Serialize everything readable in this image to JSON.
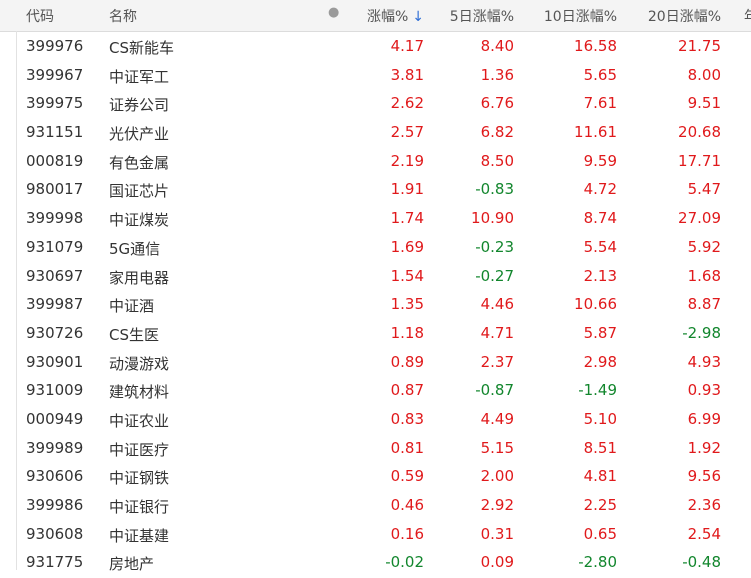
{
  "header": {
    "code": "代码",
    "name": "名称",
    "dot": "●",
    "chg": "涨幅%",
    "sort_icon": "↓",
    "chg5": "5日涨幅%",
    "chg10": "10日涨幅%",
    "chg20": "20日涨幅%",
    "more": "年"
  },
  "colors": {
    "up": "#e0191b",
    "down": "#12862d",
    "sort": "#2f6fd6"
  },
  "rows": [
    {
      "code": "399976",
      "name": "CS新能车",
      "chg": "4.17",
      "chg5": "8.40",
      "chg10": "16.58",
      "chg20": "21.75"
    },
    {
      "code": "399967",
      "name": "中证军工",
      "chg": "3.81",
      "chg5": "1.36",
      "chg10": "5.65",
      "chg20": "8.00"
    },
    {
      "code": "399975",
      "name": "证券公司",
      "chg": "2.62",
      "chg5": "6.76",
      "chg10": "7.61",
      "chg20": "9.51"
    },
    {
      "code": "931151",
      "name": "光伏产业",
      "chg": "2.57",
      "chg5": "6.82",
      "chg10": "11.61",
      "chg20": "20.68"
    },
    {
      "code": "000819",
      "name": "有色金属",
      "chg": "2.19",
      "chg5": "8.50",
      "chg10": "9.59",
      "chg20": "17.71"
    },
    {
      "code": "980017",
      "name": "国证芯片",
      "chg": "1.91",
      "chg5": "-0.83",
      "chg10": "4.72",
      "chg20": "5.47"
    },
    {
      "code": "399998",
      "name": "中证煤炭",
      "chg": "1.74",
      "chg5": "10.90",
      "chg10": "8.74",
      "chg20": "27.09"
    },
    {
      "code": "931079",
      "name": "5G通信",
      "chg": "1.69",
      "chg5": "-0.23",
      "chg10": "5.54",
      "chg20": "5.92"
    },
    {
      "code": "930697",
      "name": "家用电器",
      "chg": "1.54",
      "chg5": "-0.27",
      "chg10": "2.13",
      "chg20": "1.68"
    },
    {
      "code": "399987",
      "name": "中证酒",
      "chg": "1.35",
      "chg5": "4.46",
      "chg10": "10.66",
      "chg20": "8.87"
    },
    {
      "code": "930726",
      "name": "CS生医",
      "chg": "1.18",
      "chg5": "4.71",
      "chg10": "5.87",
      "chg20": "-2.98"
    },
    {
      "code": "930901",
      "name": "动漫游戏",
      "chg": "0.89",
      "chg5": "2.37",
      "chg10": "2.98",
      "chg20": "4.93"
    },
    {
      "code": "931009",
      "name": "建筑材料",
      "chg": "0.87",
      "chg5": "-0.87",
      "chg10": "-1.49",
      "chg20": "0.93"
    },
    {
      "code": "000949",
      "name": "中证农业",
      "chg": "0.83",
      "chg5": "4.49",
      "chg10": "5.10",
      "chg20": "6.99"
    },
    {
      "code": "399989",
      "name": "中证医疗",
      "chg": "0.81",
      "chg5": "5.15",
      "chg10": "8.51",
      "chg20": "1.92"
    },
    {
      "code": "930606",
      "name": "中证钢铁",
      "chg": "0.59",
      "chg5": "2.00",
      "chg10": "4.81",
      "chg20": "9.56"
    },
    {
      "code": "399986",
      "name": "中证银行",
      "chg": "0.46",
      "chg5": "2.92",
      "chg10": "2.25",
      "chg20": "2.36"
    },
    {
      "code": "930608",
      "name": "中证基建",
      "chg": "0.16",
      "chg5": "0.31",
      "chg10": "0.65",
      "chg20": "2.54"
    },
    {
      "code": "931775",
      "name": "房地产",
      "chg": "-0.02",
      "chg5": "0.09",
      "chg10": "-2.80",
      "chg20": "-0.48"
    }
  ]
}
